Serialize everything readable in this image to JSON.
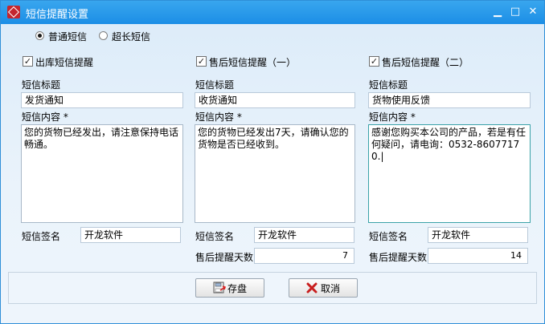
{
  "window": {
    "title": "短信提醒设置"
  },
  "sms_type": {
    "options": [
      "普通短信",
      "超长短信"
    ],
    "selected": 0
  },
  "panels": [
    {
      "header": "出库短信提醒",
      "checked": true,
      "title_label": "短信标题",
      "title_value": "发货通知",
      "content_label": "短信内容 *",
      "content_value": "您的货物已经发出，请注意保持电话畅通。",
      "sign_label": "短信签名",
      "sign_value": "开龙软件"
    },
    {
      "header": "售后短信提醒（一）",
      "checked": true,
      "title_label": "短信标题",
      "title_value": "收货通知",
      "content_label": "短信内容 *",
      "content_value": "您的货物已经发出7天，请确认您的货物是否已经收到。",
      "sign_label": "短信签名",
      "sign_value": "开龙软件",
      "days_label": "售后提醒天数",
      "days_value": "7"
    },
    {
      "header": "售后短信提醒（二）",
      "checked": true,
      "title_label": "短信标题",
      "title_value": "货物使用反馈",
      "content_label": "短信内容 *",
      "content_value": "感谢您购买本公司的产品，若是有任何疑问，请电询：0532-86077170.|",
      "sign_label": "短信签名",
      "sign_value": "开龙软件",
      "days_label": "售后提醒天数",
      "days_value": "14"
    }
  ],
  "buttons": {
    "save": "存盘",
    "cancel": "取消"
  }
}
